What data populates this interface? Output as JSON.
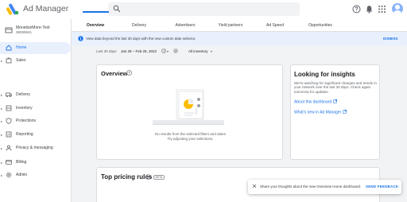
{
  "app": {
    "title": "Ad Manager",
    "brand_colors": [
      "#fbbc04",
      "#4285f4",
      "#34a853"
    ]
  },
  "header": {
    "search_placeholder": "",
    "icons": [
      "search-icon",
      "help-icon",
      "notifications-icon",
      "apps-icon",
      "avatar"
    ]
  },
  "sidebar": {
    "network_name": "MonetizeMore-Test",
    "network_id": "36055941",
    "items": [
      {
        "label": "Home",
        "icon": "home-icon",
        "active": true,
        "expandable": false
      },
      {
        "label": "Sales",
        "icon": "sales-icon",
        "active": false,
        "expandable": true
      },
      {
        "label": "Delivery",
        "icon": "delivery-icon",
        "active": false,
        "expandable": true
      },
      {
        "label": "Inventory",
        "icon": "inventory-icon",
        "active": false,
        "expandable": true
      },
      {
        "label": "Protections",
        "icon": "shield-icon",
        "active": false,
        "expandable": true
      },
      {
        "label": "Reporting",
        "icon": "reporting-icon",
        "active": false,
        "expandable": true
      },
      {
        "label": "Privacy & messaging",
        "icon": "privacy-icon",
        "active": false,
        "expandable": true
      },
      {
        "label": "Billing",
        "icon": "billing-icon",
        "active": false,
        "expandable": true
      },
      {
        "label": "Admin",
        "icon": "admin-icon",
        "active": false,
        "expandable": true
      }
    ]
  },
  "tabs": [
    {
      "label": "Overview",
      "active": true
    },
    {
      "label": "Delivery",
      "active": false
    },
    {
      "label": "Advertisers",
      "active": false
    },
    {
      "label": "Yield partners",
      "active": false
    },
    {
      "label": "Ad Speed",
      "active": false
    },
    {
      "label": "Opportunities",
      "active": false
    }
  ],
  "banner": {
    "text": "View data beyond the last 30 days with the new custom date selector.",
    "dismiss_label": "DISMISS"
  },
  "filters": {
    "range_label": "Last 30 days",
    "date_range": "Jan 28 – Feb 26, 2022",
    "inventory_label": "All inventory"
  },
  "overview": {
    "title": "Overview",
    "empty_line1": "No results from the selected filters and dates",
    "empty_line2": "Try adjusting your selections."
  },
  "insights": {
    "title": "Looking for insights",
    "description": "We're watching for significant changes and trends in your network over the last 30 days. Check again tomorrow for updates.",
    "link1": "About this dashboard",
    "link2": "What's new in Ad Manager"
  },
  "pricing": {
    "title": "Top pricing rules",
    "badge": "BETA"
  },
  "snackbar": {
    "message": "Share your thoughts about the new Overview Home dashboard.",
    "action_label": "SEND FEEDBACK"
  }
}
